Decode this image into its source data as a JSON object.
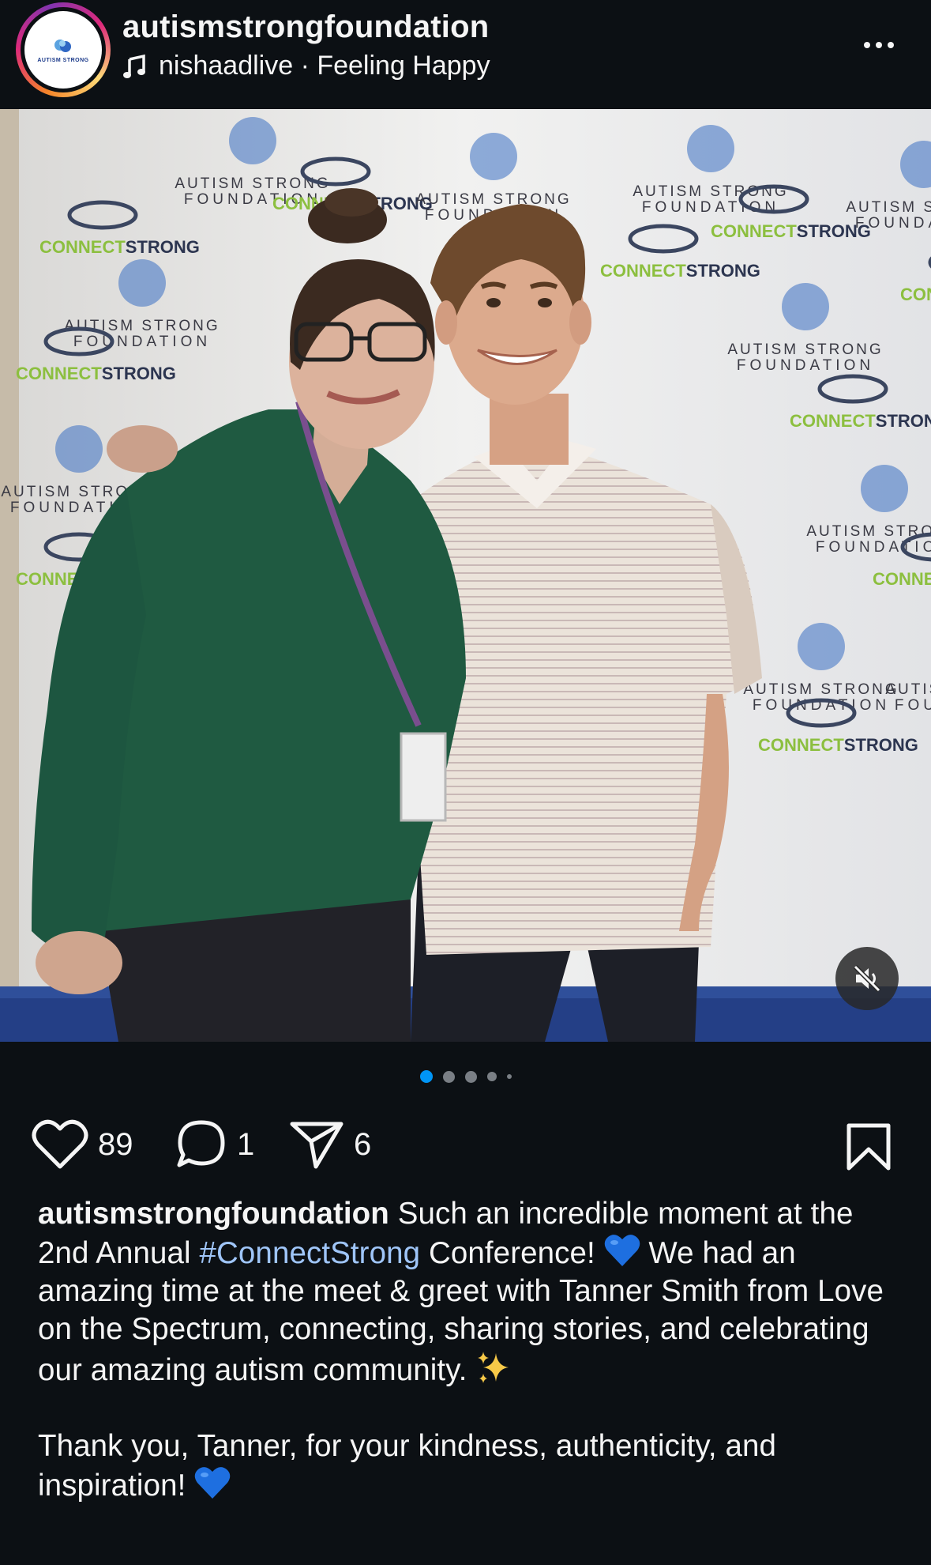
{
  "header": {
    "username": "autismstrongfoundation",
    "audio": "nishaadlive",
    "separator": " · ",
    "status": "Feeling Happy",
    "avatar_text": "AUTISM STRONG"
  },
  "photo": {
    "backdrop_text_primary": "AUTISM STRONG",
    "backdrop_text_secondary": "FOUNDATION",
    "backdrop_text_connect": "CONNECT",
    "backdrop_text_strong": "STRONG",
    "brand_blue": "#3a6fc2",
    "brand_green": "#8cbf3f"
  },
  "carousel": {
    "total": 5,
    "active": 0
  },
  "actions": {
    "likes": "89",
    "comments": "1",
    "shares": "6"
  },
  "caption": {
    "username": "autismstrongfoundation",
    "text_1": " Such an incredible moment at the 2nd Annual ",
    "hashtag": "#ConnectStrong",
    "text_2": " Conference! ",
    "text_3": " We had an amazing time at the meet & greet with Tanner Smith from Love on the Spectrum, connecting, sharing stories, and celebrating our amazing autism community. ",
    "text_4": "Thank you, Tanner, for your kindness, authenticity, and inspiration! "
  },
  "colors": {
    "background": "#0c1014",
    "text": "#f5f5f5",
    "hashtag": "#9fc5f8",
    "dot_active": "#0095f6",
    "heart_emoji": "#1e6fe0"
  }
}
